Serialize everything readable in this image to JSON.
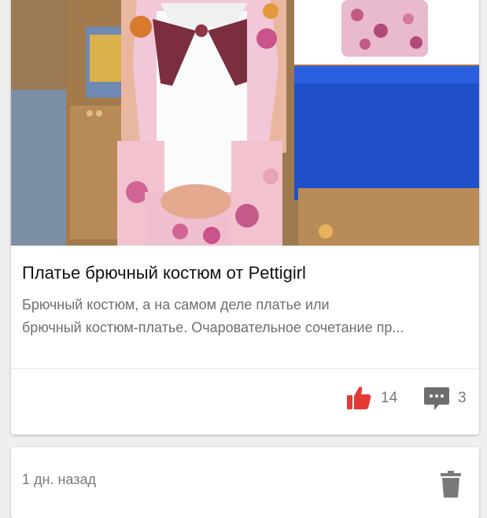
{
  "post": {
    "title": "Платье брючный костюм от Pettigirl",
    "excerpt_line1": "Брючный костюм, а на самом деле платье или",
    "excerpt_line2": "брючный костюм-платье. Очаровательное сочетание пр...",
    "likes": "14",
    "comments": "3",
    "image_icon": "photo-girl-in-floral-dress",
    "accent_color": "#e53935"
  },
  "next_post": {
    "time": "1 дн. назад",
    "delete_icon": "trash-icon"
  }
}
